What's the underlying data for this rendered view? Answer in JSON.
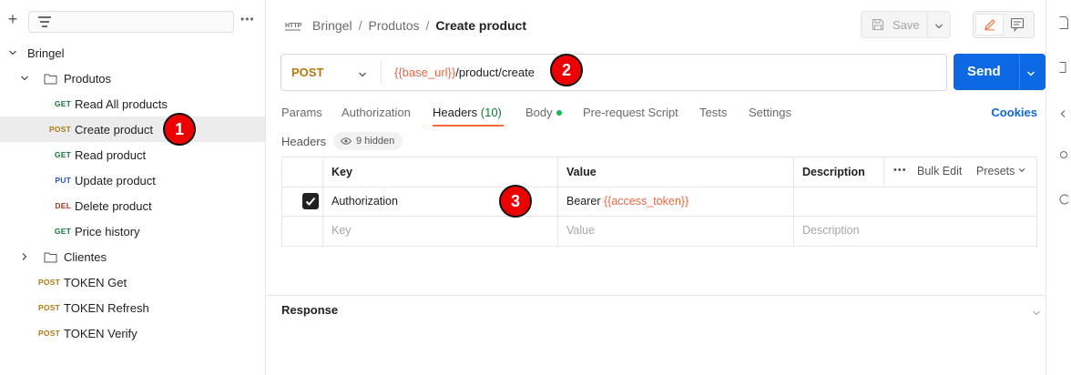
{
  "sidebar": {
    "more_label": "•••",
    "workspace": "Bringel",
    "folders": {
      "produtos": "Produtos",
      "clientes": "Clientes"
    },
    "items": [
      {
        "method": "GET",
        "label": "Read All products"
      },
      {
        "method": "POST",
        "label": "Create product"
      },
      {
        "method": "GET",
        "label": "Read product"
      },
      {
        "method": "PUT",
        "label": "Update product"
      },
      {
        "method": "DEL",
        "label": "Delete product"
      },
      {
        "method": "GET",
        "label": "Price history"
      }
    ],
    "root_items": [
      {
        "method": "POST",
        "label": "TOKEN Get"
      },
      {
        "method": "POST",
        "label": "TOKEN Refresh"
      },
      {
        "method": "POST",
        "label": "TOKEN Verify"
      }
    ]
  },
  "breadcrumb": {
    "workspace": "Bringel",
    "folder": "Produtos",
    "current": "Create product",
    "sep": "/"
  },
  "toolbar": {
    "save_label": "Save"
  },
  "request": {
    "method": "POST",
    "url_var": "{{base_url}}",
    "url_path": "/product/create",
    "send_label": "Send"
  },
  "tabs": {
    "params": "Params",
    "authorization": "Authorization",
    "headers": "Headers",
    "headers_count": "(10)",
    "body": "Body",
    "prerequest": "Pre-request Script",
    "tests": "Tests",
    "settings": "Settings",
    "cookies": "Cookies"
  },
  "headers_section": {
    "title": "Headers",
    "hidden": "9 hidden"
  },
  "table": {
    "col_key": "Key",
    "col_value": "Value",
    "col_desc": "Description",
    "more": "•••",
    "bulk_edit": "Bulk Edit",
    "presets": "Presets",
    "row": {
      "key": "Authorization",
      "value_prefix": "Bearer ",
      "value_var": "{{access_token}}",
      "checked": true
    },
    "placeholder": {
      "key": "Key",
      "value": "Value",
      "desc": "Description"
    }
  },
  "response": {
    "title": "Response"
  },
  "annotations": [
    "1",
    "2",
    "3"
  ],
  "colors": {
    "accent": "#ff6c37",
    "send": "#0c69e3",
    "post": "#b5780c",
    "get": "#0e7a34",
    "put": "#1a56c5",
    "del": "#b5300c",
    "variable": "#e8663d",
    "badge": "#ee0000"
  }
}
